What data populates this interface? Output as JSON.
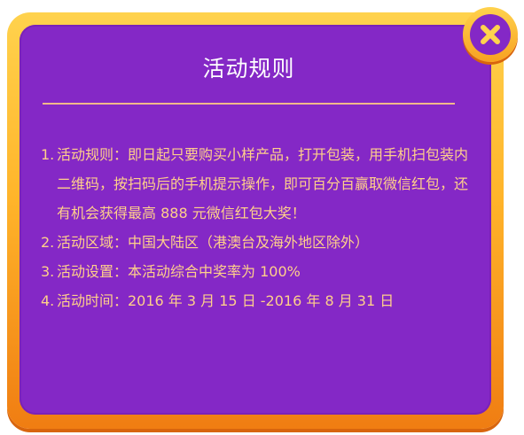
{
  "dialog": {
    "title": "活动规则",
    "close_label": "×",
    "rules": [
      {
        "number": "1.",
        "text": "活动规则：即日起只要购买小样产品，打开包装，用手机扫包装内二维码，按扫码后的手机提示操作，即可百分百赢取微信红包，还有机会获得最高 888 元微信红包大奖！"
      },
      {
        "number": "2.",
        "text": "活动区域：中国大陆区（港澳台及海外地区除外）"
      },
      {
        "number": "3.",
        "text": "活动设置：本活动综合中奖率为 100%"
      },
      {
        "number": "4.",
        "text": "活动时间：2016 年 3 月 15 日 -2016 年 8 月 31 日"
      }
    ]
  },
  "colors": {
    "panel_purple": "#8428c6",
    "frame_orange": "#f8a221",
    "rule_text": "#ffd08a",
    "title_text": "#ffffff"
  },
  "icons": {
    "close": "close-icon"
  }
}
